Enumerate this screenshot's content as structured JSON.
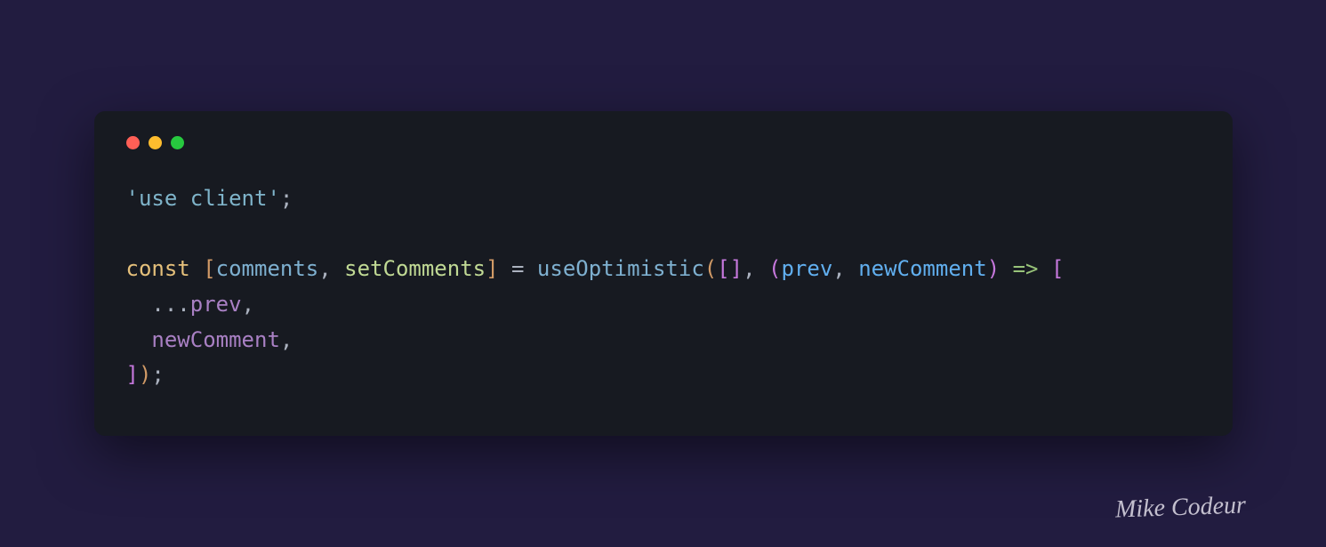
{
  "window": {
    "traffic_lights": {
      "red": "#ff5f56",
      "yellow": "#ffbd2e",
      "green": "#27c93f"
    }
  },
  "code": {
    "tokens": [
      {
        "text": "'use client'",
        "cls": "tok-string"
      },
      {
        "text": ";",
        "cls": "tok-punct"
      },
      {
        "text": "\n\n",
        "cls": ""
      },
      {
        "text": "const",
        "cls": "tok-keyword"
      },
      {
        "text": " ",
        "cls": ""
      },
      {
        "text": "[",
        "cls": "tok-bracket1"
      },
      {
        "text": "comments",
        "cls": "tok-var"
      },
      {
        "text": ", ",
        "cls": "tok-punct"
      },
      {
        "text": "setComments",
        "cls": "tok-func-var"
      },
      {
        "text": "]",
        "cls": "tok-bracket1"
      },
      {
        "text": " = ",
        "cls": "tok-punct"
      },
      {
        "text": "useOptimistic",
        "cls": "tok-func"
      },
      {
        "text": "(",
        "cls": "tok-bracket1"
      },
      {
        "text": "[",
        "cls": "tok-bracket2"
      },
      {
        "text": "]",
        "cls": "tok-bracket2"
      },
      {
        "text": ", ",
        "cls": "tok-punct"
      },
      {
        "text": "(",
        "cls": "tok-bracket2"
      },
      {
        "text": "prev",
        "cls": "tok-param"
      },
      {
        "text": ", ",
        "cls": "tok-punct"
      },
      {
        "text": "newComment",
        "cls": "tok-param"
      },
      {
        "text": ")",
        "cls": "tok-bracket2"
      },
      {
        "text": " ",
        "cls": ""
      },
      {
        "text": "=>",
        "cls": "tok-arrow"
      },
      {
        "text": " ",
        "cls": ""
      },
      {
        "text": "[",
        "cls": "tok-bracket2"
      },
      {
        "text": "\n  ",
        "cls": ""
      },
      {
        "text": "...",
        "cls": "tok-spread"
      },
      {
        "text": "prev",
        "cls": "tok-prop"
      },
      {
        "text": ",",
        "cls": "tok-punct"
      },
      {
        "text": "\n  ",
        "cls": ""
      },
      {
        "text": "newComment",
        "cls": "tok-prop"
      },
      {
        "text": ",",
        "cls": "tok-punct"
      },
      {
        "text": "\n",
        "cls": ""
      },
      {
        "text": "]",
        "cls": "tok-bracket2"
      },
      {
        "text": ")",
        "cls": "tok-bracket1"
      },
      {
        "text": ";",
        "cls": "tok-punct"
      }
    ]
  },
  "signature": "Mike Codeur"
}
